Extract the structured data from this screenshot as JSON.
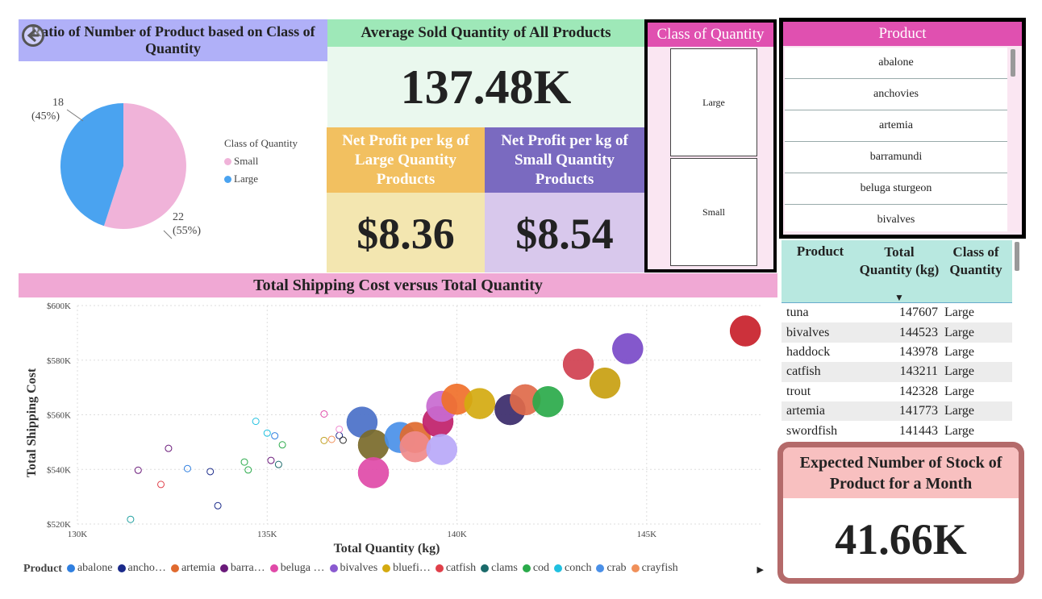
{
  "pie": {
    "title": "Ratio of Number of Product based on Class of Quantity",
    "legend_title": "Class of Quantity",
    "legend": [
      {
        "label": "Small",
        "color": "#f0b3d9"
      },
      {
        "label": "Large",
        "color": "#4aa3f0"
      }
    ],
    "label_large_count": "18",
    "label_large_pct": "(45%)",
    "label_small_count": "22",
    "label_small_pct": "(55%)"
  },
  "avg_sold": {
    "title": "Average Sold Quantity of All Products",
    "value": "137.48K"
  },
  "profit_large": {
    "title": "Net Profit per kg of Large Quantity Products",
    "value": "$8.36"
  },
  "profit_small": {
    "title": "Net Profit per kg of Small Quantity Products",
    "value": "$8.54"
  },
  "class_slicer": {
    "title": "Class of Quantity",
    "options": [
      "Large",
      "Small"
    ]
  },
  "product_slicer": {
    "title": "Product",
    "items": [
      "abalone",
      "anchovies",
      "artemia",
      "barramundi",
      "beluga sturgeon",
      "bivalves"
    ]
  },
  "table": {
    "headers": [
      "Product",
      "Total Quantity (kg)",
      "Class of Quantity"
    ],
    "rows": [
      [
        "tuna",
        "147607",
        "Large"
      ],
      [
        "bivalves",
        "144523",
        "Large"
      ],
      [
        "haddock",
        "143978",
        "Large"
      ],
      [
        "catfish",
        "143211",
        "Large"
      ],
      [
        "trout",
        "142328",
        "Large"
      ],
      [
        "artemia",
        "141773",
        "Large"
      ],
      [
        "swordfish",
        "141443",
        "Large"
      ]
    ]
  },
  "expected": {
    "title": "Expected Number of Stock of Product for a Month",
    "value": "41.66K"
  },
  "scatter_legend": {
    "title": "Product",
    "items": [
      {
        "label": "abalone",
        "color": "#2f7fe0"
      },
      {
        "label": "ancho…",
        "color": "#1a2a8a"
      },
      {
        "label": "artemia",
        "color": "#e06a2f"
      },
      {
        "label": "barra…",
        "color": "#6a1a7a"
      },
      {
        "label": "beluga …",
        "color": "#e04aa8"
      },
      {
        "label": "bivalves",
        "color": "#8a5ad0"
      },
      {
        "label": "bluefi…",
        "color": "#d4aa10"
      },
      {
        "label": "catfish",
        "color": "#e0404a"
      },
      {
        "label": "clams",
        "color": "#1a6a6a"
      },
      {
        "label": "cod",
        "color": "#2aaa4a"
      },
      {
        "label": "conch",
        "color": "#20c0e0"
      },
      {
        "label": "crab",
        "color": "#4a90e8"
      },
      {
        "label": "crayfish",
        "color": "#f0905a"
      }
    ]
  },
  "chart_data": {
    "type": "scatter",
    "title": "Total Shipping Cost versus Total Quantity",
    "xlabel": "Total Quantity (kg)",
    "ylabel": "Total Shipping Cost",
    "xlim": [
      130000,
      148000
    ],
    "ylim": [
      520000,
      600000
    ],
    "xticks": [
      "130K",
      "135K",
      "140K",
      "145K"
    ],
    "yticks": [
      "$520K",
      "$540K",
      "$560K",
      "$580K",
      "$600K"
    ],
    "grid": true,
    "points": [
      {
        "x": 131400,
        "y": 521700,
        "color": "#20a0a0",
        "filled": false
      },
      {
        "x": 131600,
        "y": 539700,
        "color": "#6a1a7a",
        "filled": false
      },
      {
        "x": 132200,
        "y": 534500,
        "color": "#e0404a",
        "filled": false
      },
      {
        "x": 132400,
        "y": 547700,
        "color": "#6a1a7a",
        "filled": false
      },
      {
        "x": 132900,
        "y": 540300,
        "color": "#2f7fe0",
        "filled": false
      },
      {
        "x": 133500,
        "y": 539200,
        "color": "#1a2a8a",
        "filled": false
      },
      {
        "x": 133700,
        "y": 526700,
        "color": "#1a2a8a",
        "filled": false
      },
      {
        "x": 134400,
        "y": 542700,
        "color": "#2aaa4a",
        "filled": false
      },
      {
        "x": 134500,
        "y": 539800,
        "color": "#2aaa4a",
        "filled": false
      },
      {
        "x": 134700,
        "y": 557600,
        "color": "#20c0e0",
        "filled": false
      },
      {
        "x": 135000,
        "y": 553300,
        "color": "#20c0e0",
        "filled": false
      },
      {
        "x": 135100,
        "y": 543300,
        "color": "#6a1a7a",
        "filled": false
      },
      {
        "x": 135200,
        "y": 552300,
        "color": "#2f7fe0",
        "filled": false
      },
      {
        "x": 135300,
        "y": 541800,
        "color": "#1a6a6a",
        "filled": false
      },
      {
        "x": 135400,
        "y": 549000,
        "color": "#2aaa4a",
        "filled": false
      },
      {
        "x": 136500,
        "y": 560300,
        "color": "#e04aa8",
        "filled": false
      },
      {
        "x": 136500,
        "y": 550600,
        "color": "#c0a020",
        "filled": false
      },
      {
        "x": 136700,
        "y": 551000,
        "color": "#f0905a",
        "filled": false
      },
      {
        "x": 136900,
        "y": 552400,
        "color": "#1a2a8a",
        "filled": false
      },
      {
        "x": 136900,
        "y": 554700,
        "color": "#f08ad0",
        "filled": false
      },
      {
        "x": 137000,
        "y": 550700,
        "color": "#222222",
        "filled": false
      },
      {
        "x": 137500,
        "y": 557300,
        "color": "#4a70c8",
        "filled": true,
        "size": 19
      },
      {
        "x": 137800,
        "y": 548900,
        "color": "#7a6a2a",
        "filled": true,
        "size": 19
      },
      {
        "x": 137800,
        "y": 538800,
        "color": "#e04aa8",
        "filled": true,
        "size": 19
      },
      {
        "x": 138500,
        "y": 551700,
        "color": "#4a90e8",
        "filled": true,
        "size": 19
      },
      {
        "x": 138900,
        "y": 551700,
        "color": "#e06a2f",
        "filled": true,
        "size": 19
      },
      {
        "x": 138900,
        "y": 548300,
        "color": "#f08a8a",
        "filled": true,
        "size": 19
      },
      {
        "x": 139500,
        "y": 557500,
        "color": "#c0206a",
        "filled": true,
        "size": 19
      },
      {
        "x": 139600,
        "y": 563100,
        "color": "#c86ad0",
        "filled": true,
        "size": 19
      },
      {
        "x": 139600,
        "y": 547300,
        "color": "#b8a8f8",
        "filled": true,
        "size": 19
      },
      {
        "x": 140000,
        "y": 565700,
        "color": "#f0702a",
        "filled": true,
        "size": 19
      },
      {
        "x": 140600,
        "y": 564100,
        "color": "#d4aa10",
        "filled": true,
        "size": 19
      },
      {
        "x": 141400,
        "y": 561900,
        "color": "#3a2a6a",
        "filled": true,
        "size": 19
      },
      {
        "x": 141800,
        "y": 565500,
        "color": "#e06a4a",
        "filled": true,
        "size": 19
      },
      {
        "x": 142400,
        "y": 564800,
        "color": "#2aaa4a",
        "filled": true,
        "size": 19
      },
      {
        "x": 143200,
        "y": 578500,
        "color": "#d04050",
        "filled": true,
        "size": 19
      },
      {
        "x": 143900,
        "y": 571600,
        "color": "#c8a010",
        "filled": true,
        "size": 19
      },
      {
        "x": 144500,
        "y": 584200,
        "color": "#7a4ac8",
        "filled": true,
        "size": 19
      },
      {
        "x": 147600,
        "y": 590700,
        "color": "#c8202a",
        "filled": true,
        "size": 19
      }
    ]
  }
}
